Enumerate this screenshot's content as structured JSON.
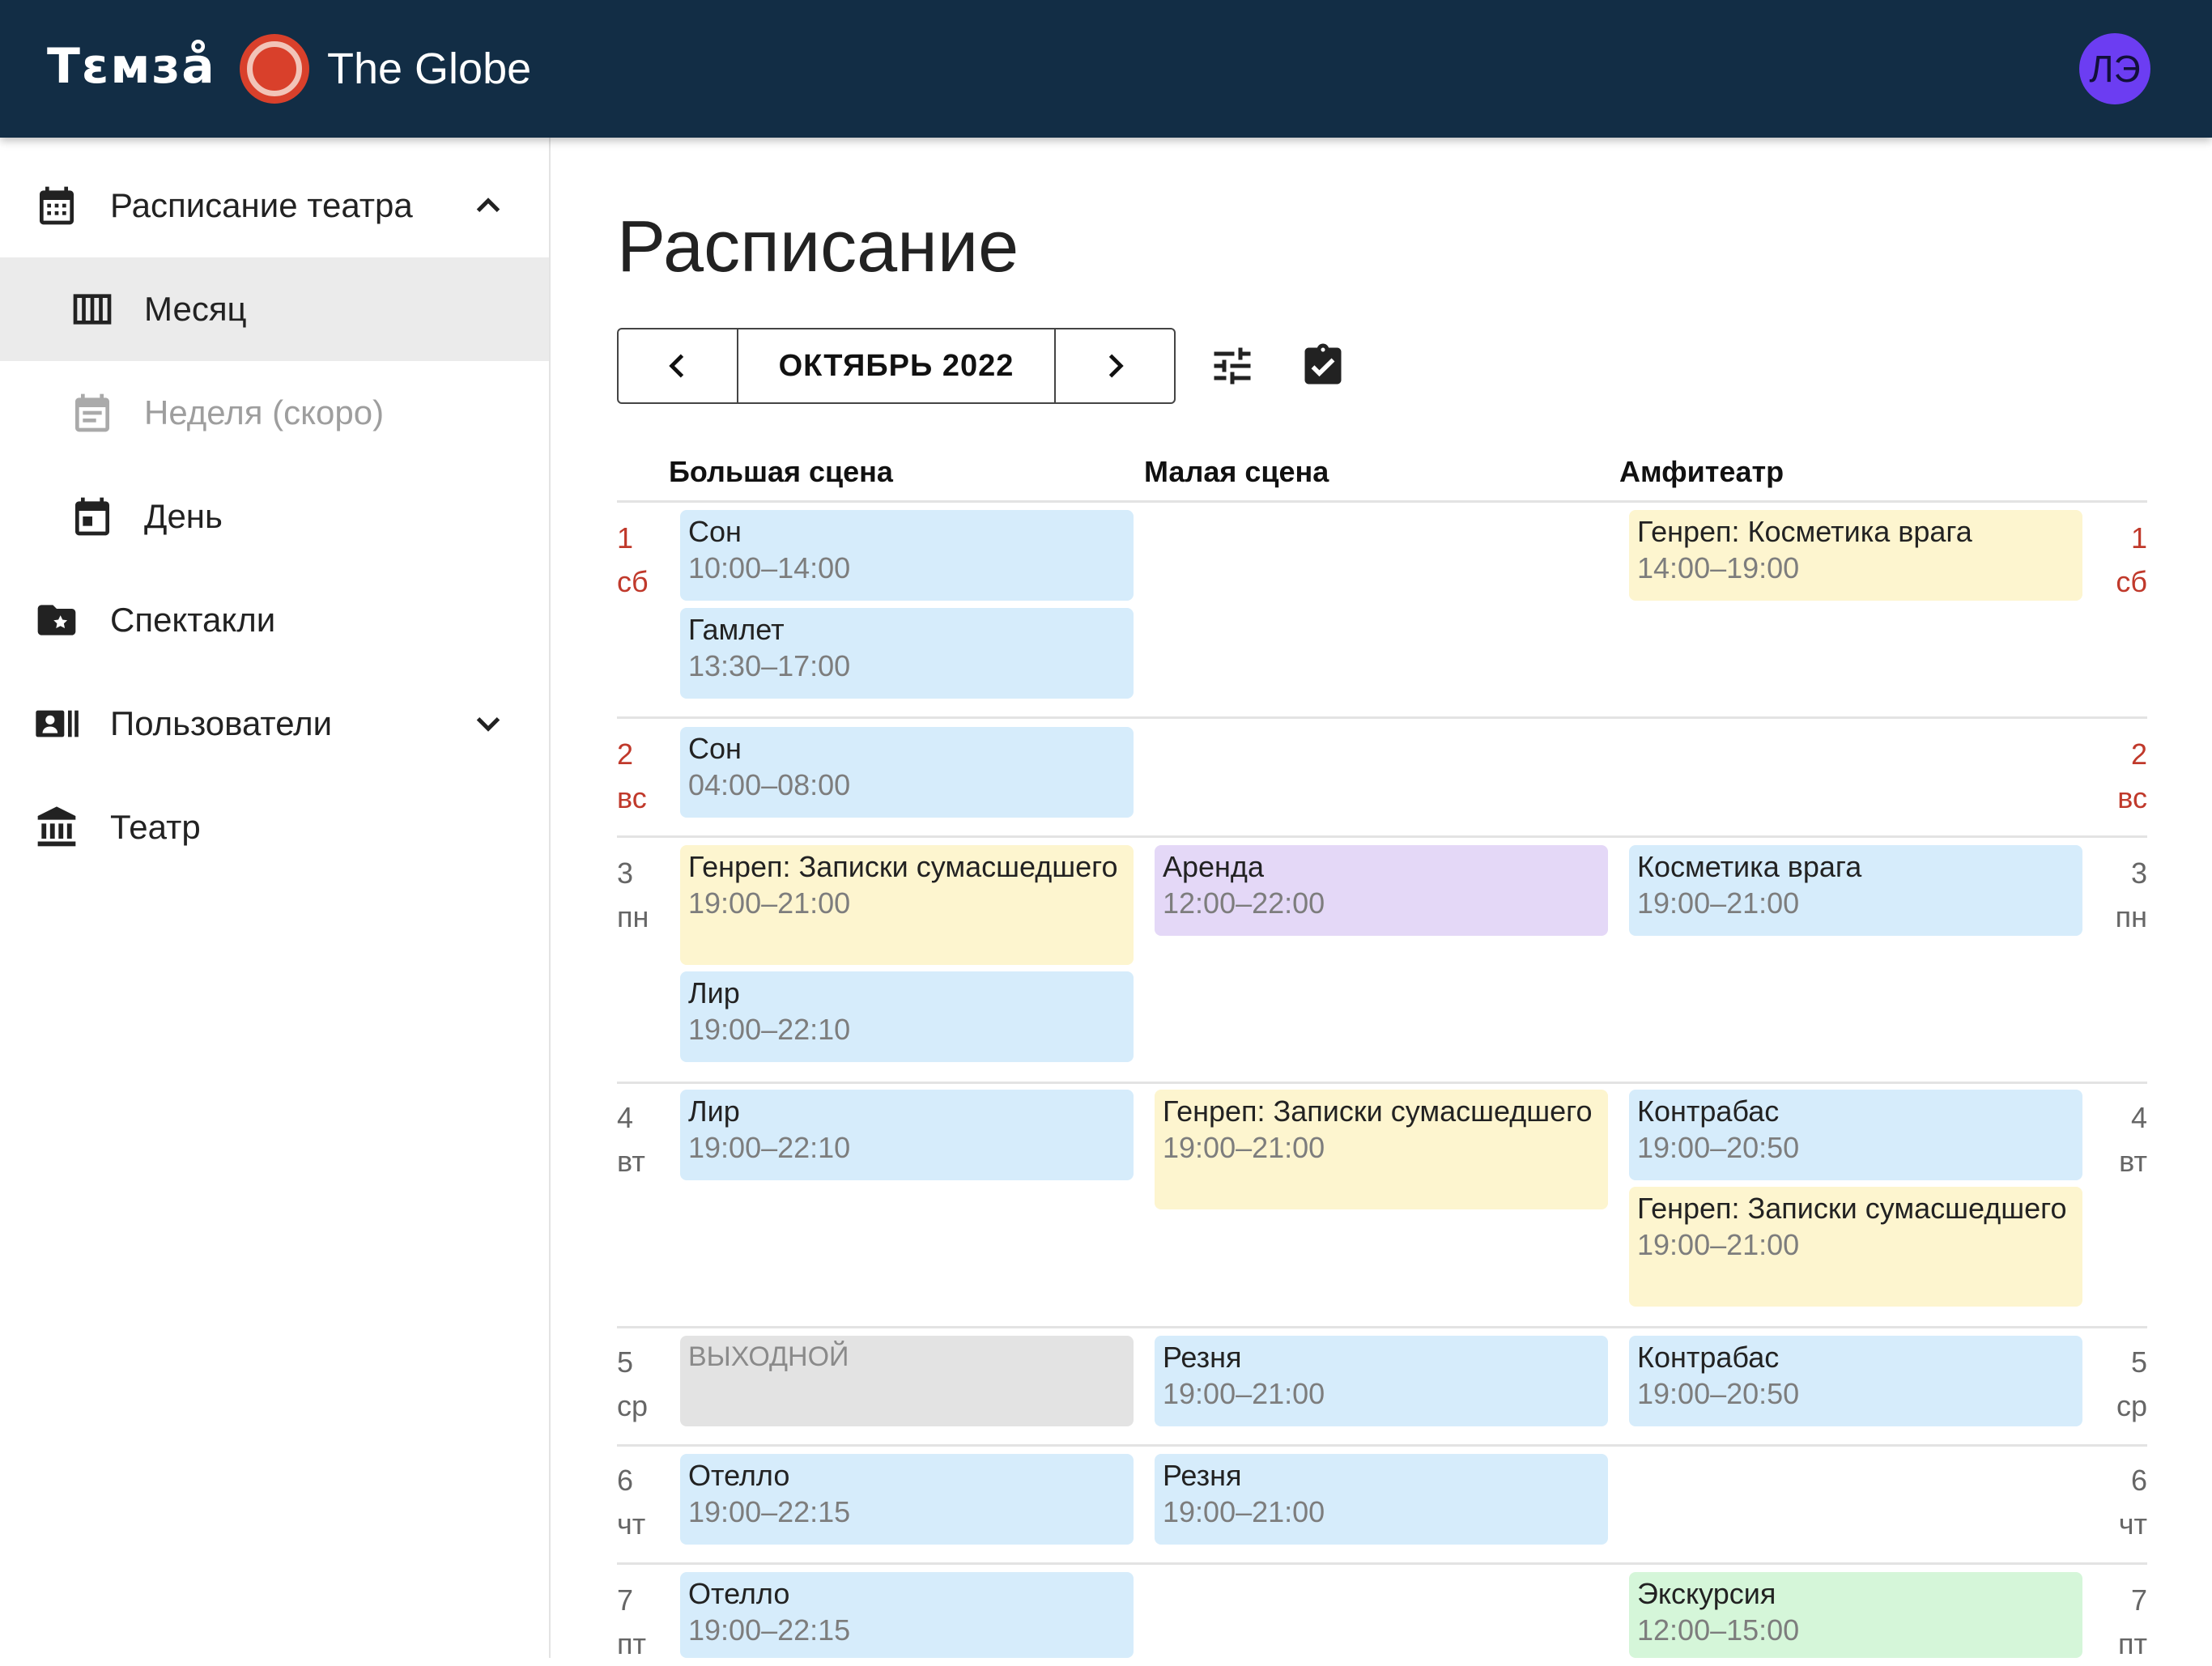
{
  "header": {
    "logo": "Тɛмзå",
    "theatre_name": "The Globe",
    "avatar_initials": "ЛЭ"
  },
  "sidebar": {
    "items": [
      {
        "label": "Расписание театра",
        "icon": "calendar-month-icon",
        "chevron": "up"
      },
      {
        "label": "Месяц",
        "icon": "view-week-icon",
        "active": true
      },
      {
        "label": "Неделя (скоро)",
        "icon": "calendar-week-icon",
        "disabled": true
      },
      {
        "label": "День",
        "icon": "calendar-today-icon"
      },
      {
        "label": "Спектакли",
        "icon": "folder-star-icon"
      },
      {
        "label": "Пользователи",
        "icon": "contacts-icon",
        "chevron": "down"
      },
      {
        "label": "Театр",
        "icon": "theatre-building-icon"
      }
    ]
  },
  "main": {
    "title": "Расписание",
    "month_label": "ОКТЯБРЬ 2022",
    "columns": [
      "Большая сцена",
      "Малая сцена",
      "Амфитеатр"
    ],
    "days": [
      {
        "num": "1",
        "wd": "сб",
        "weekend": true
      },
      {
        "num": "2",
        "wd": "вс",
        "weekend": true
      },
      {
        "num": "3",
        "wd": "пн"
      },
      {
        "num": "4",
        "wd": "вт"
      },
      {
        "num": "5",
        "wd": "ср"
      },
      {
        "num": "6",
        "wd": "чт"
      },
      {
        "num": "7",
        "wd": "пт"
      }
    ],
    "events": [
      {
        "title": "Сон",
        "time": "10:00–14:00",
        "color": "blue"
      },
      {
        "title": "Гамлет",
        "time": "13:30–17:00",
        "color": "blue"
      },
      {
        "title": "Генреп: Косметика врага",
        "time": "14:00–19:00",
        "color": "yellow"
      },
      {
        "title": "Сон",
        "time": "04:00–08:00",
        "color": "blue"
      },
      {
        "title": "Генреп: Записки сумасшедшего",
        "time": "19:00–21:00",
        "color": "yellow"
      },
      {
        "title": "Лир",
        "time": "19:00–22:10",
        "color": "blue"
      },
      {
        "title": "Аренда",
        "time": "12:00–22:00",
        "color": "purple"
      },
      {
        "title": "Косметика врага",
        "time": "19:00–21:00",
        "color": "blue"
      },
      {
        "title": "Лир",
        "time": "19:00–22:10",
        "color": "blue"
      },
      {
        "title": "Генреп: Записки сумасшедшего",
        "time": "19:00–21:00",
        "color": "yellow"
      },
      {
        "title": "Контрабас",
        "time": "19:00–20:50",
        "color": "blue"
      },
      {
        "title": "Генреп: Записки сумасшедшего",
        "time": "19:00–21:00",
        "color": "yellow"
      },
      {
        "title": "ВЫХОДНОЙ",
        "time": "",
        "color": "gray"
      },
      {
        "title": "Резня",
        "time": "19:00–21:00",
        "color": "blue"
      },
      {
        "title": "Контрабас",
        "time": "19:00–20:50",
        "color": "blue"
      },
      {
        "title": "Отелло",
        "time": "19:00–22:15",
        "color": "blue"
      },
      {
        "title": "Резня",
        "time": "19:00–21:00",
        "color": "blue"
      },
      {
        "title": "Отелло",
        "time": "19:00–22:15",
        "color": "blue"
      },
      {
        "title": "Экскурсия",
        "time": "12:00–15:00",
        "color": "green"
      }
    ],
    "colors": {
      "header_bg": "#122d45",
      "blue": "#d6ecfb",
      "yellow": "#fdf5cf",
      "purple": "#e4d8f7",
      "green": "#d5f6d9",
      "gray": "#e3e3e3",
      "weekend": "#c0392b"
    }
  }
}
